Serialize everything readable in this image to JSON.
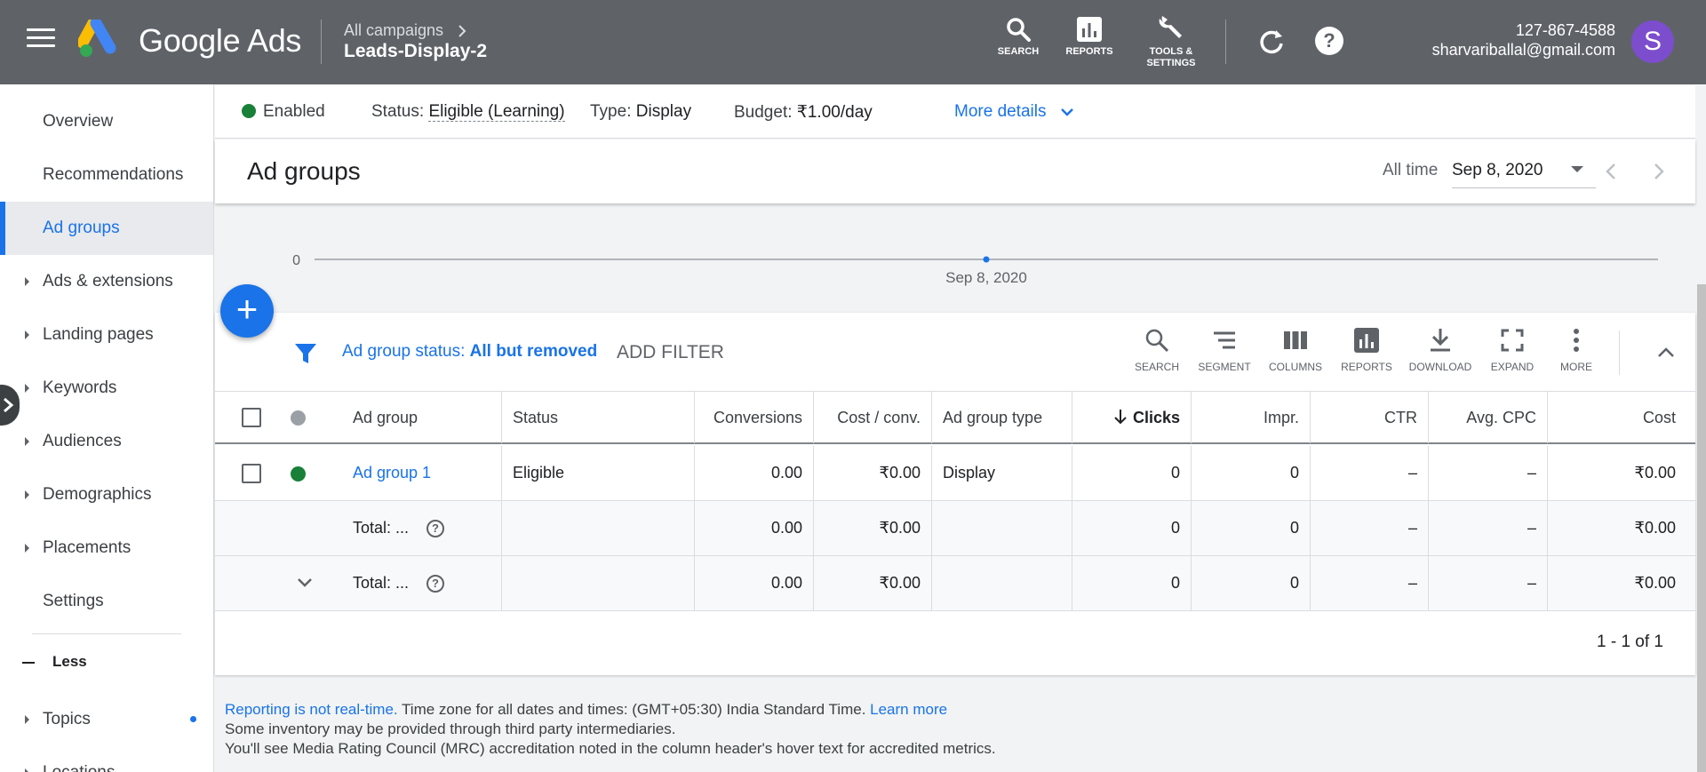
{
  "header": {
    "brand": "Google Ads",
    "breadcrumb_parent": "All campaigns",
    "campaign_name": "Leads-Display-2",
    "tools": [
      {
        "label": "SEARCH",
        "icon": "search-icon"
      },
      {
        "label": "REPORTS",
        "icon": "reports-icon"
      },
      {
        "label": "TOOLS &",
        "label2": "SETTINGS",
        "icon": "wrench-icon"
      }
    ],
    "account_id": "127-867-4588",
    "account_email": "sharvariballal@gmail.com",
    "avatar_letter": "S",
    "help_glyph": "?"
  },
  "sidebar": {
    "items": [
      {
        "label": "Overview"
      },
      {
        "label": "Recommendations"
      },
      {
        "label": "Ad groups"
      },
      {
        "label": "Ads & extensions"
      },
      {
        "label": "Landing pages"
      },
      {
        "label": "Keywords"
      },
      {
        "label": "Audiences"
      },
      {
        "label": "Demographics"
      },
      {
        "label": "Placements"
      },
      {
        "label": "Settings"
      },
      {
        "label": "Less"
      },
      {
        "label": "Topics"
      },
      {
        "label": "Locations"
      }
    ]
  },
  "statusbar": {
    "enabled": "Enabled",
    "status_label": "Status:",
    "status_value": "Eligible (Learning)",
    "type_label": "Type:",
    "type_value": "Display",
    "budget_label": "Budget:",
    "budget_value": "₹1.00/day",
    "more_details": "More details"
  },
  "page": {
    "title": "Ad groups",
    "date_range_label": "All time",
    "date_value": "Sep 8, 2020"
  },
  "chart_data": {
    "type": "line",
    "x": [
      "Sep 8, 2020"
    ],
    "y": [
      0
    ],
    "y_tick": "0",
    "x_tick": "Sep 8, 2020"
  },
  "filter": {
    "label": "Ad group status:",
    "value": "All but removed",
    "add_filter": "ADD FILTER"
  },
  "table_toolbar": [
    {
      "label": "SEARCH"
    },
    {
      "label": "SEGMENT"
    },
    {
      "label": "COLUMNS"
    },
    {
      "label": "REPORTS"
    },
    {
      "label": "DOWNLOAD"
    },
    {
      "label": "EXPAND"
    },
    {
      "label": "MORE"
    }
  ],
  "table": {
    "columns": [
      "Ad group",
      "Status",
      "Conversions",
      "Cost / conv.",
      "Ad group type",
      "Clicks",
      "Impr.",
      "CTR",
      "Avg. CPC",
      "Cost"
    ],
    "rows": [
      [
        "Ad group 1",
        "Eligible",
        "0.00",
        "₹0.00",
        "Display",
        "0",
        "0",
        "–",
        "–",
        "₹0.00"
      ]
    ],
    "totals": [
      [
        "Total: ...",
        "",
        "0.00",
        "₹0.00",
        "",
        "0",
        "0",
        "–",
        "–",
        "₹0.00"
      ],
      [
        "Total: ...",
        "",
        "0.00",
        "₹0.00",
        "",
        "0",
        "0",
        "–",
        "–",
        "₹0.00"
      ]
    ],
    "pagination": "1 - 1 of 1"
  },
  "footer": {
    "reporting_link": "Reporting is not real-time.",
    "timezone_text": " Time zone for all dates and times: (GMT+05:30) India Standard Time. ",
    "learn_more": "Learn more",
    "line2": "Some inventory may be provided through third party intermediaries.",
    "line3": "You'll see Media Rating Council (MRC) accreditation noted in the column header's hover text for accredited metrics."
  },
  "colors": {
    "header_bg": "#5f6368",
    "accent": "#1a73e8",
    "enabled_green": "#188038"
  }
}
